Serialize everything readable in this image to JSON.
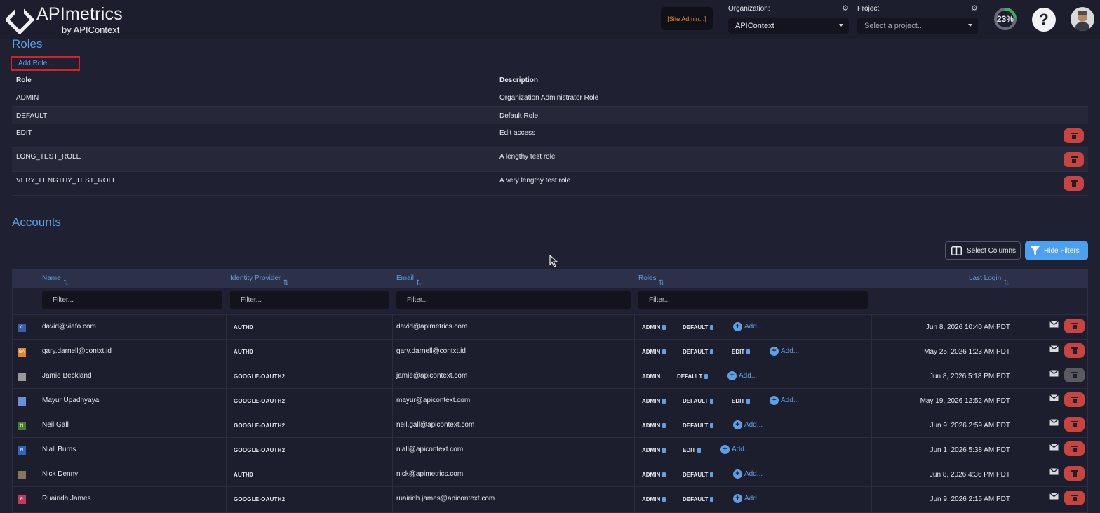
{
  "header": {
    "brand": "APImetrics",
    "brand_sub": "by APIContext",
    "site_admin": "[Site Admin...]",
    "org_label": "Organization:",
    "org_value": "APIContext",
    "project_label": "Project:",
    "project_placeholder": "Select a project...",
    "progress_percent": 23,
    "progress_text": "23%",
    "help": "?"
  },
  "roles": {
    "title": "Roles",
    "add_label": "Add Role...",
    "col_role": "Role",
    "col_description": "Description",
    "rows": [
      {
        "role": "ADMIN",
        "description": "Organization Administrator Role",
        "deletable": false
      },
      {
        "role": "DEFAULT",
        "description": "Default Role",
        "deletable": false
      },
      {
        "role": "EDIT",
        "description": "Edit access",
        "deletable": true
      },
      {
        "role": "LONG_TEST_ROLE",
        "description": "A lengthy test role",
        "deletable": true
      },
      {
        "role": "VERY_LENGTHY_TEST_ROLE",
        "description": "A very lengthy test role",
        "deletable": true
      }
    ]
  },
  "accounts": {
    "title": "Accounts",
    "select_columns": "Select Columns",
    "hide_filters": "Hide Filters",
    "col_name": "Name",
    "col_idp": "Identity Provider",
    "col_email": "Email",
    "col_roles": "Roles",
    "col_last_login": "Last Login",
    "filter_placeholder": "Filter...",
    "add_link": "Add...",
    "rows": [
      {
        "avatar": "C",
        "avatar_color": "#3d5fa8",
        "name": "david@viafo.com",
        "idp": "AUTH0",
        "email": "david@apimetrics.com",
        "roles": [
          {
            "name": "ADMIN",
            "removable": true
          },
          {
            "name": "DEFAULT",
            "removable": true
          }
        ],
        "last_login": "Jun 8, 2026 10:40 AM PDT",
        "deletable": true
      },
      {
        "avatar": "GA",
        "avatar_color": "#e0822f",
        "name": "gary.darnell@contxt.id",
        "idp": "AUTH0",
        "email": "gary.darnell@contxt.id",
        "roles": [
          {
            "name": "ADMIN",
            "removable": true
          },
          {
            "name": "DEFAULT",
            "removable": true
          },
          {
            "name": "EDIT",
            "removable": true
          }
        ],
        "last_login": "May 25, 2026 1:23 AM PDT",
        "deletable": true
      },
      {
        "avatar": "",
        "avatar_color": "#9a9a9a",
        "name": "Jamie Beckland",
        "idp": "GOOGLE-OAUTH2",
        "email": "jamie@apicontext.com",
        "roles": [
          {
            "name": "ADMIN",
            "removable": false
          },
          {
            "name": "DEFAULT",
            "removable": true
          }
        ],
        "last_login": "Jun 8, 2026 5:18 PM PDT",
        "deletable": false
      },
      {
        "avatar": "",
        "avatar_color": "#6e8fd8",
        "name": "Mayur Upadhyaya",
        "idp": "GOOGLE-OAUTH2",
        "email": "mayur@apicontext.com",
        "roles": [
          {
            "name": "ADMIN",
            "removable": true
          },
          {
            "name": "DEFAULT",
            "removable": true
          },
          {
            "name": "EDIT",
            "removable": true
          }
        ],
        "last_login": "May 19, 2026 12:52 AM PDT",
        "deletable": true
      },
      {
        "avatar": "N",
        "avatar_color": "#4f7a2e",
        "name": "Neil Gall",
        "idp": "GOOGLE-OAUTH2",
        "email": "neil.gall@apicontext.com",
        "roles": [
          {
            "name": "ADMIN",
            "removable": true
          },
          {
            "name": "DEFAULT",
            "removable": true
          }
        ],
        "last_login": "Jun 9, 2026 2:59 AM PDT",
        "deletable": true
      },
      {
        "avatar": "N",
        "avatar_color": "#2f65b8",
        "name": "Niall Burns",
        "idp": "GOOGLE-OAUTH2",
        "email": "niall@apicontext.com",
        "roles": [
          {
            "name": "ADMIN",
            "removable": true
          },
          {
            "name": "EDIT",
            "removable": true
          }
        ],
        "last_login": "Jun 1, 2026 5:38 AM PDT",
        "deletable": true
      },
      {
        "avatar": "",
        "avatar_color": "#8a7460",
        "name": "Nick Denny",
        "idp": "AUTH0",
        "email": "nick@apimetrics.com",
        "roles": [
          {
            "name": "ADMIN",
            "removable": true
          },
          {
            "name": "DEFAULT",
            "removable": true
          }
        ],
        "last_login": "Jun 8, 2026 4:36 PM PDT",
        "deletable": true
      },
      {
        "avatar": "R",
        "avatar_color": "#c23a5e",
        "name": "Ruairidh James",
        "idp": "GOOGLE-OAUTH2",
        "email": "ruairidh.james@apicontext.com",
        "roles": [
          {
            "name": "ADMIN",
            "removable": true
          },
          {
            "name": "DEFAULT",
            "removable": true
          }
        ],
        "last_login": "Jun 9, 2026 2:15 AM PDT",
        "deletable": true
      }
    ]
  },
  "colors": {
    "accent": "#5f9fe6",
    "danger": "#c9443f",
    "background": "#1f2133",
    "focus_outline": "#d4212b"
  }
}
